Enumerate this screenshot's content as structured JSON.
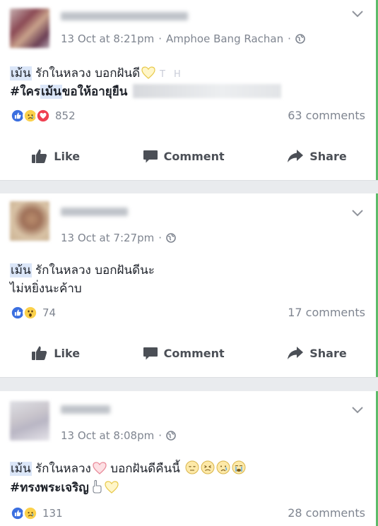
{
  "posts": [
    {
      "time": "13 Oct at 8:21pm",
      "location": "Amphoe Bang Rachan",
      "line1_tag": "เม้น",
      "line1_text": " รักในหลวง บอกฝันดี",
      "line2_hash": "#ใคร",
      "line2_hl": "เม้น",
      "line2_text": "ขอให้อายุยืน",
      "react_count": "852",
      "comments": "63 comments",
      "reactions": [
        "like-icon",
        "sad-icon",
        "love-icon"
      ]
    },
    {
      "time": "13 Oct at 7:27pm",
      "line1_tag": "เม้น",
      "line1_text": " รักในหลวง บอกฝันดีนะ",
      "line2_text": "ไม่หยิ่งนะค้าบ",
      "react_count": "74",
      "comments": "17 comments",
      "reactions": [
        "like-icon",
        "wow-icon"
      ]
    },
    {
      "time": "13 Oct at 8:08pm",
      "line1_tag": "เม้น",
      "line1_text": " รักในหลวง",
      "line1_text_b": " บอกฝันดีคืนนี้ ",
      "line2_hash": "#ทรงพระเจริญ",
      "react_count": "131",
      "comments": "28 comments",
      "reactions": [
        "like-icon",
        "sad-icon"
      ]
    }
  ],
  "actions": {
    "like": "Like",
    "comment": "Comment",
    "share": "Share"
  },
  "colors": {
    "like_blue": "#3b6fe0",
    "love_red": "#ef4152",
    "sad_yellow": "#fbd14b",
    "meta_gray": "#7f8590",
    "action_gray": "#4b4f56"
  }
}
